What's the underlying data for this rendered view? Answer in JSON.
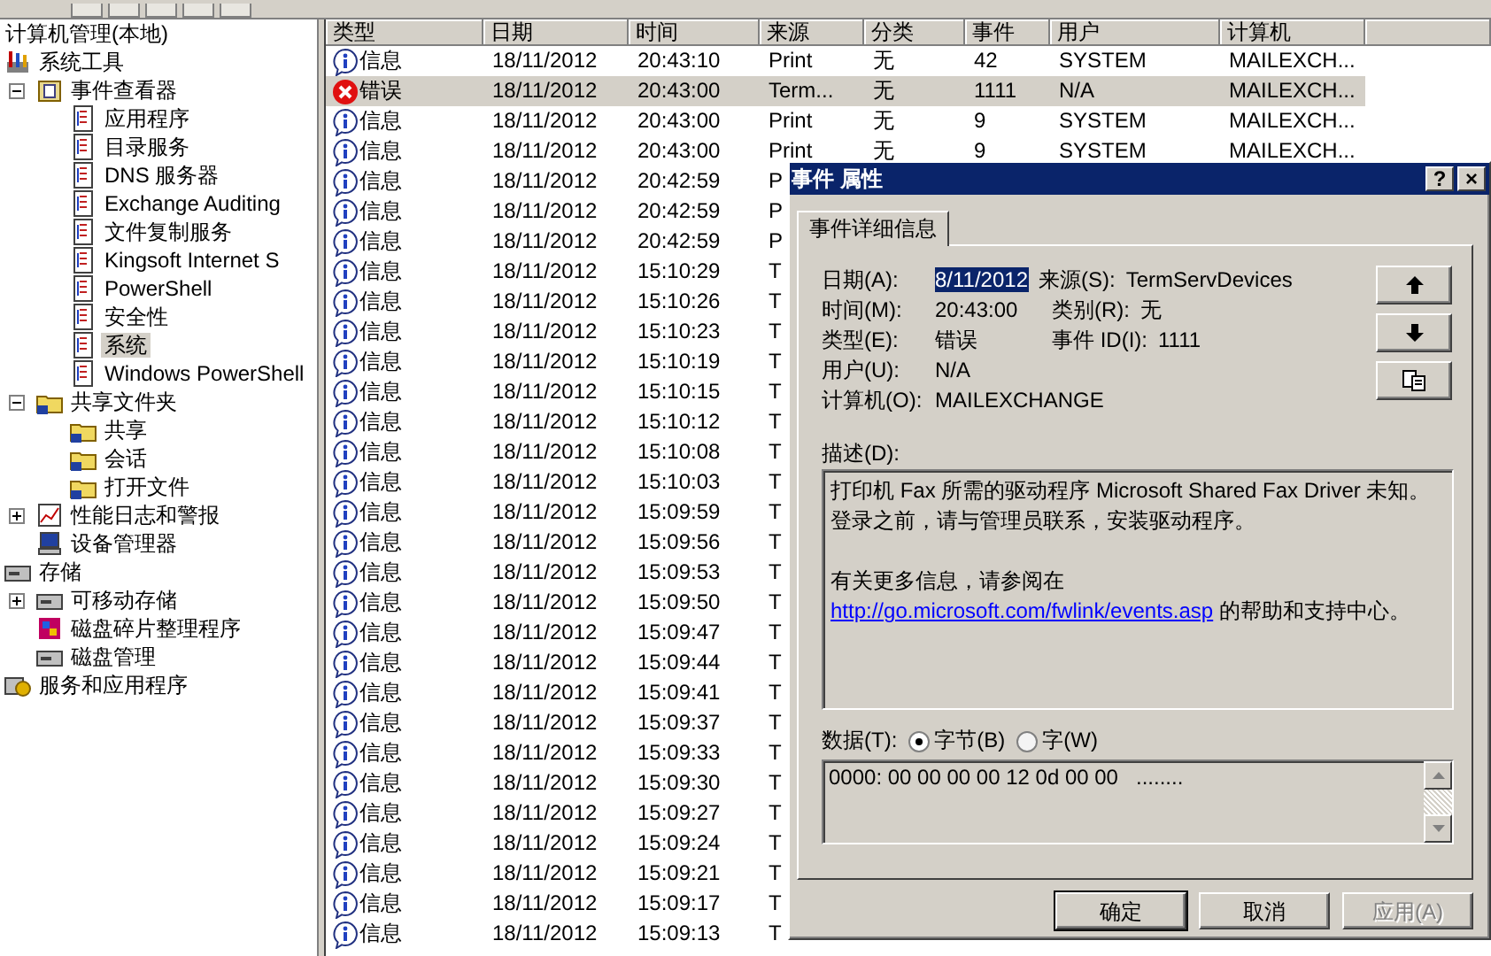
{
  "tree": {
    "title": "计算机管理(本地)",
    "items": [
      {
        "label": "系统工具",
        "kind": "tools",
        "selected": false,
        "children": [
          {
            "label": "事件查看器",
            "kind": "viewer",
            "selected": false,
            "expanded": true,
            "children": [
              {
                "label": "应用程序",
                "kind": "log",
                "selected": false
              },
              {
                "label": "目录服务",
                "kind": "log",
                "selected": false
              },
              {
                "label": "DNS 服务器",
                "kind": "log",
                "selected": false
              },
              {
                "label": "Exchange Auditing",
                "kind": "log",
                "selected": false
              },
              {
                "label": "文件复制服务",
                "kind": "log",
                "selected": false
              },
              {
                "label": "Kingsoft Internet S",
                "kind": "log",
                "selected": false
              },
              {
                "label": "PowerShell",
                "kind": "log",
                "selected": false
              },
              {
                "label": "安全性",
                "kind": "log",
                "selected": false
              },
              {
                "label": "系统",
                "kind": "log",
                "selected": true
              },
              {
                "label": "Windows PowerShell",
                "kind": "log",
                "selected": false
              }
            ]
          },
          {
            "label": "共享文件夹",
            "kind": "share",
            "selected": false,
            "expanded": true,
            "children": [
              {
                "label": "共享",
                "kind": "share",
                "selected": false
              },
              {
                "label": "会话",
                "kind": "share",
                "selected": false
              },
              {
                "label": "打开文件",
                "kind": "share",
                "selected": false
              }
            ]
          },
          {
            "label": "性能日志和警报",
            "kind": "perf",
            "selected": false,
            "expanded": false
          },
          {
            "label": "设备管理器",
            "kind": "device",
            "selected": false
          }
        ]
      },
      {
        "label": "存储",
        "kind": "storage",
        "selected": false,
        "children": [
          {
            "label": "可移动存储",
            "kind": "storage",
            "selected": false,
            "expanded": false
          },
          {
            "label": "磁盘碎片整理程序",
            "kind": "defrag",
            "selected": false
          },
          {
            "label": "磁盘管理",
            "kind": "storage",
            "selected": false
          }
        ]
      },
      {
        "label": "服务和应用程序",
        "kind": "services",
        "selected": false
      }
    ]
  },
  "list": {
    "columns": [
      "类型",
      "日期",
      "时间",
      "来源",
      "分类",
      "事件",
      "用户",
      "计算机"
    ],
    "rows": [
      {
        "kind": "info",
        "selected": false,
        "cells": [
          "信息",
          "18/11/2012",
          "20:43:10",
          "Print",
          "无",
          "42",
          "SYSTEM",
          "MAILEXCH..."
        ]
      },
      {
        "kind": "error",
        "selected": true,
        "cells": [
          "错误",
          "18/11/2012",
          "20:43:00",
          "Term...",
          "无",
          "1111",
          "N/A",
          "MAILEXCH..."
        ]
      },
      {
        "kind": "info",
        "selected": false,
        "cells": [
          "信息",
          "18/11/2012",
          "20:43:00",
          "Print",
          "无",
          "9",
          "SYSTEM",
          "MAILEXCH..."
        ]
      },
      {
        "kind": "info",
        "selected": false,
        "cells": [
          "信息",
          "18/11/2012",
          "20:43:00",
          "Print",
          "无",
          "9",
          "SYSTEM",
          "MAILEXCH..."
        ]
      },
      {
        "kind": "info",
        "selected": false,
        "cells": [
          "信息",
          "18/11/2012",
          "20:42:59",
          "P"
        ]
      },
      {
        "kind": "info",
        "selected": false,
        "cells": [
          "信息",
          "18/11/2012",
          "20:42:59",
          "P"
        ]
      },
      {
        "kind": "info",
        "selected": false,
        "cells": [
          "信息",
          "18/11/2012",
          "20:42:59",
          "P"
        ]
      },
      {
        "kind": "info",
        "selected": false,
        "cells": [
          "信息",
          "18/11/2012",
          "15:10:29",
          "T"
        ]
      },
      {
        "kind": "info",
        "selected": false,
        "cells": [
          "信息",
          "18/11/2012",
          "15:10:26",
          "T"
        ]
      },
      {
        "kind": "info",
        "selected": false,
        "cells": [
          "信息",
          "18/11/2012",
          "15:10:23",
          "T"
        ]
      },
      {
        "kind": "info",
        "selected": false,
        "cells": [
          "信息",
          "18/11/2012",
          "15:10:19",
          "T"
        ]
      },
      {
        "kind": "info",
        "selected": false,
        "cells": [
          "信息",
          "18/11/2012",
          "15:10:15",
          "T"
        ]
      },
      {
        "kind": "info",
        "selected": false,
        "cells": [
          "信息",
          "18/11/2012",
          "15:10:12",
          "T"
        ]
      },
      {
        "kind": "info",
        "selected": false,
        "cells": [
          "信息",
          "18/11/2012",
          "15:10:08",
          "T"
        ]
      },
      {
        "kind": "info",
        "selected": false,
        "cells": [
          "信息",
          "18/11/2012",
          "15:10:03",
          "T"
        ]
      },
      {
        "kind": "info",
        "selected": false,
        "cells": [
          "信息",
          "18/11/2012",
          "15:09:59",
          "T"
        ]
      },
      {
        "kind": "info",
        "selected": false,
        "cells": [
          "信息",
          "18/11/2012",
          "15:09:56",
          "T"
        ]
      },
      {
        "kind": "info",
        "selected": false,
        "cells": [
          "信息",
          "18/11/2012",
          "15:09:53",
          "T"
        ]
      },
      {
        "kind": "info",
        "selected": false,
        "cells": [
          "信息",
          "18/11/2012",
          "15:09:50",
          "T"
        ]
      },
      {
        "kind": "info",
        "selected": false,
        "cells": [
          "信息",
          "18/11/2012",
          "15:09:47",
          "T"
        ]
      },
      {
        "kind": "info",
        "selected": false,
        "cells": [
          "信息",
          "18/11/2012",
          "15:09:44",
          "T"
        ]
      },
      {
        "kind": "info",
        "selected": false,
        "cells": [
          "信息",
          "18/11/2012",
          "15:09:41",
          "T"
        ]
      },
      {
        "kind": "info",
        "selected": false,
        "cells": [
          "信息",
          "18/11/2012",
          "15:09:37",
          "T"
        ]
      },
      {
        "kind": "info",
        "selected": false,
        "cells": [
          "信息",
          "18/11/2012",
          "15:09:33",
          "T"
        ]
      },
      {
        "kind": "info",
        "selected": false,
        "cells": [
          "信息",
          "18/11/2012",
          "15:09:30",
          "T"
        ]
      },
      {
        "kind": "info",
        "selected": false,
        "cells": [
          "信息",
          "18/11/2012",
          "15:09:27",
          "T"
        ]
      },
      {
        "kind": "info",
        "selected": false,
        "cells": [
          "信息",
          "18/11/2012",
          "15:09:24",
          "T"
        ]
      },
      {
        "kind": "info",
        "selected": false,
        "cells": [
          "信息",
          "18/11/2012",
          "15:09:21",
          "T"
        ]
      },
      {
        "kind": "info",
        "selected": false,
        "cells": [
          "信息",
          "18/11/2012",
          "15:09:17",
          "T"
        ]
      },
      {
        "kind": "info",
        "selected": false,
        "cells": [
          "信息",
          "18/11/2012",
          "15:09:13",
          "T"
        ]
      }
    ]
  },
  "dialog": {
    "title": "事件 属性",
    "help_button": "?",
    "close_button": "×",
    "tabs": [
      {
        "label": "事件详细信息",
        "selected": true
      }
    ],
    "details": [
      {
        "label": "日期(A):",
        "value": "8/11/2012",
        "highlighted": true,
        "side_label": "来源(S):",
        "side_value": "TermServDevices"
      },
      {
        "label": "时间(M):",
        "value": "20:43:00",
        "highlighted": false,
        "side_label": "类别(R):",
        "side_value": "无"
      },
      {
        "label": "类型(E):",
        "value": "错误",
        "highlighted": false,
        "side_label": "事件 ID(I):",
        "side_value": "1111"
      },
      {
        "label": "用户(U):",
        "value": "N/A",
        "highlighted": false
      },
      {
        "label": "计算机(O):",
        "value": "MAILEXCHANGE",
        "highlighted": false
      }
    ],
    "description_label": "描述(D):",
    "description": "打印机 Fax 所需的驱动程序 Microsoft Shared Fax Driver 未知。登录之前，请与管理员联系，安装驱动程序。",
    "more_info": "有关更多信息，请参阅在",
    "link": "http://go.microsoft.com/fwlink/events.asp",
    "after_link": "的帮助和支持中心。",
    "data_label": "数据(T):",
    "radios": [
      {
        "label": "字节(B)",
        "selected": true
      },
      {
        "label": "字(W)",
        "selected": false
      }
    ],
    "data_text": "0000: 00 00 00 00 12 0d 00 00   ........",
    "buttons": [
      {
        "label": "确定",
        "default": true,
        "disabled": false
      },
      {
        "label": "取消",
        "default": false,
        "disabled": false
      },
      {
        "label": "应用(A)",
        "default": false,
        "disabled": true
      }
    ]
  }
}
